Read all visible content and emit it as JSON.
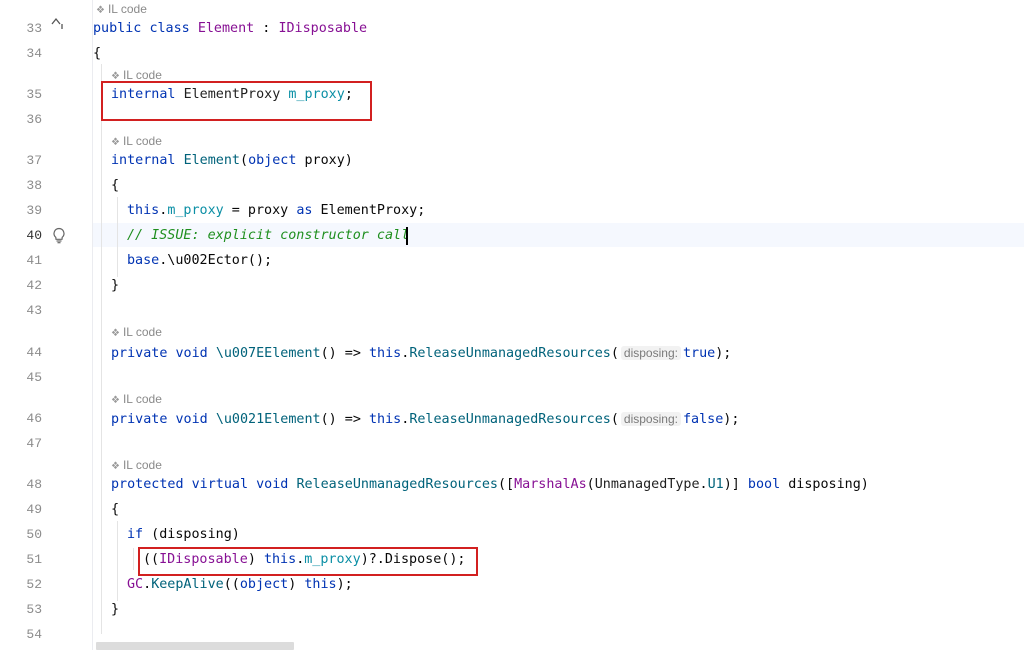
{
  "hints": {
    "il_code": "IL code"
  },
  "gutter": {
    "lines": [
      "33",
      "34",
      "35",
      "36",
      "37",
      "38",
      "39",
      "40",
      "41",
      "42",
      "43",
      "44",
      "45",
      "46",
      "47",
      "48",
      "49",
      "50",
      "51",
      "52",
      "53",
      "54"
    ],
    "fold_icon": "chevron-up-icon",
    "bulb_icon": "lightbulb-icon"
  },
  "code": {
    "l33": {
      "kw1": "public",
      "kw2": "class",
      "cls": "Element",
      "sep": " : ",
      "iface": "IDisposable"
    },
    "l34": {
      "text": "{"
    },
    "l35": {
      "kw": "internal",
      "type": "ElementProxy",
      "field": "m_proxy",
      "end": ";"
    },
    "l37": {
      "kw": "internal",
      "name": "Element",
      "open": "(",
      "ptype": "object",
      "pname": " proxy)"
    },
    "l38": {
      "text": "{"
    },
    "l39": {
      "kw": "this",
      "dot": ".",
      "field": "m_proxy",
      "mid": " = proxy ",
      "as": "as",
      "type": " ElementProxy;"
    },
    "l40": {
      "comment": "// ISSUE: explicit constructor call"
    },
    "l41": {
      "kw": "base",
      "rest": ".\\u002Ector();"
    },
    "l42": {
      "text": "}"
    },
    "l44": {
      "kw1": "private",
      "kw2": "void",
      "name": "\\u007EElement",
      "arrow": "() => ",
      "this": "this",
      "dot": ".",
      "call": "ReleaseUnmanagedResources",
      "open": "(",
      "param": "disposing:",
      "val": "true",
      "end": ");"
    },
    "l46": {
      "kw1": "private",
      "kw2": "void",
      "name": "\\u0021Element",
      "arrow": "() => ",
      "this": "this",
      "dot": ".",
      "call": "ReleaseUnmanagedResources",
      "open": "(",
      "param": "disposing:",
      "val": "false",
      "end": ");"
    },
    "l48": {
      "kw1": "protected",
      "kw2": "virtual",
      "kw3": "void",
      "name": "ReleaseUnmanagedResources",
      "open": "([",
      "attr": "MarshalAs",
      "aopen": "(",
      "enumtype": "UnmanagedType",
      "edot": ".",
      "enumval": "U1",
      "aclose": ")] ",
      "btype": "bool",
      "pname": " disposing)"
    },
    "l49": {
      "text": "{"
    },
    "l50": {
      "kw": "if",
      "rest": " (disposing)"
    },
    "l51": {
      "open": "((",
      "type": "IDisposable",
      "mid": ") ",
      "this": "this",
      "dot": ".",
      "field": "m_proxy",
      "rest": ")?.Dispose();"
    },
    "l52": {
      "cls": "GC",
      "dot": ".",
      "call": "KeepAlive",
      "open": "((",
      "type": "object",
      "mid": ") ",
      "this": "this",
      "end": ");"
    },
    "l53": {
      "text": "}"
    }
  }
}
